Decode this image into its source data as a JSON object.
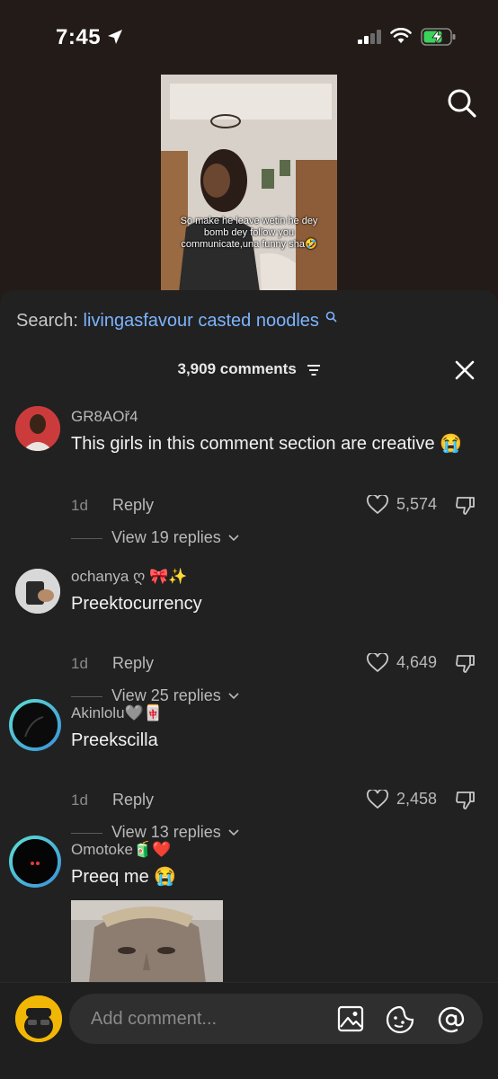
{
  "status": {
    "time": "7:45"
  },
  "video": {
    "caption": "So make he leave wetin he dey bomb dey follow you communicate,una funny sha🤣"
  },
  "search": {
    "label": "Search:",
    "query": "livingasfavour casted noodles"
  },
  "comments_header": {
    "count_label": "3,909 comments"
  },
  "comments": [
    {
      "username": "GR8AOř4",
      "text": "This girls in this comment section are creative 😭",
      "date": "1d",
      "reply_label": "Reply",
      "likes": "5,574",
      "view_replies": "View 19 replies"
    },
    {
      "username": "ochanya ღ 🎀✨",
      "text": "Preektocurrency",
      "date": "1d",
      "reply_label": "Reply",
      "likes": "4,649",
      "view_replies": "View 25 replies"
    },
    {
      "username": "Akinlolu🩶🀄",
      "text": "Preekscilla",
      "date": "1d",
      "reply_label": "Reply",
      "likes": "2,458",
      "view_replies": "View 13 replies"
    },
    {
      "username": "Omotoke🧃❤️",
      "text": "Preeq me 😭"
    }
  ],
  "composer": {
    "placeholder": "Add comment..."
  },
  "colors": {
    "link": "#7cb4ff",
    "sheet": "#212121",
    "background": "#221b17"
  },
  "icons": [
    "location-arrow-icon",
    "signal-icon",
    "wifi-icon",
    "battery-charging-icon",
    "search-icon",
    "filter-icon",
    "close-icon",
    "heart-icon",
    "dislike-icon",
    "chevron-down-icon",
    "image-icon",
    "sticker-icon",
    "mention-icon"
  ]
}
